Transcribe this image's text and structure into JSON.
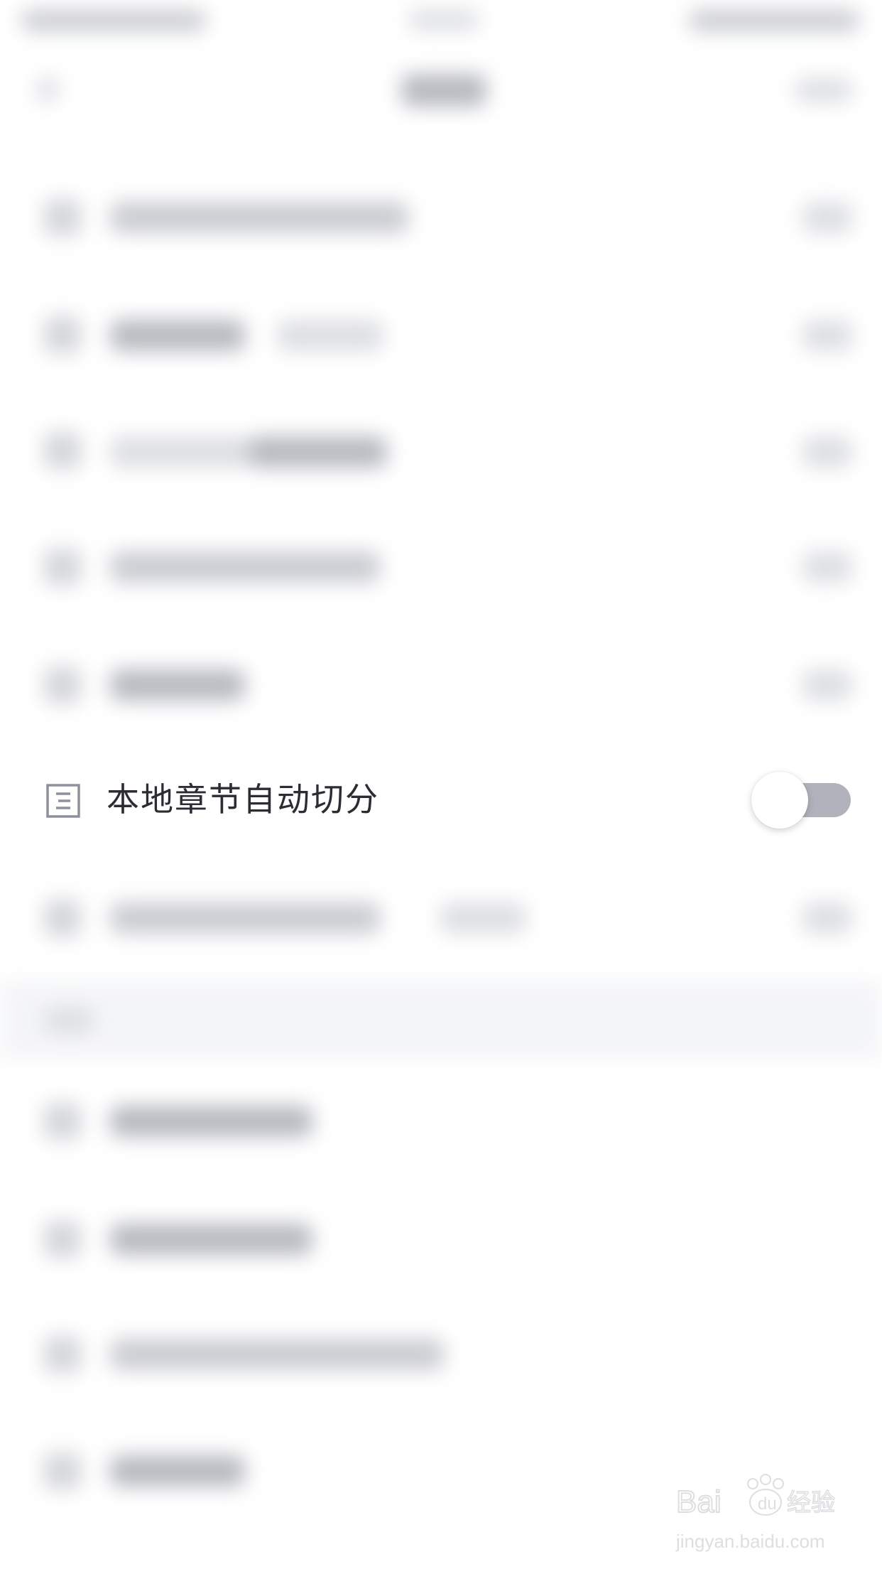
{
  "settings_row": {
    "label": "本地章节自动切分",
    "toggle_on": false,
    "icon": "document-list-icon"
  },
  "colors": {
    "label_text": "#2b2d33",
    "toggle_track_off": "#b1b2bb",
    "toggle_knob": "#ffffff",
    "icon_stroke": "#8e909b"
  },
  "watermark": {
    "brand": "Baidu经验",
    "url": "jingyan.baidu.com"
  }
}
